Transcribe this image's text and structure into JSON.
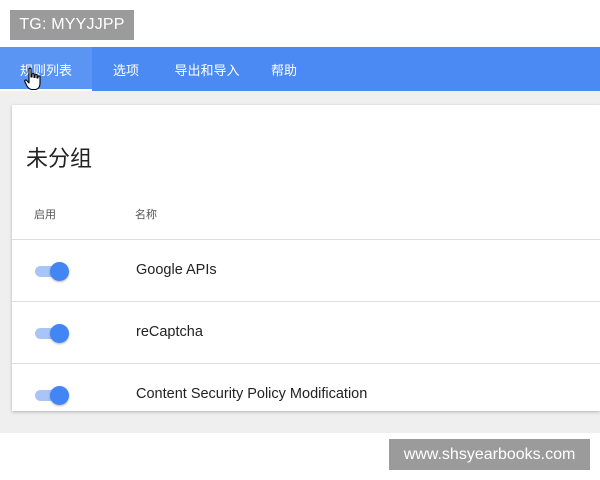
{
  "watermark_top": "TG: MYYJJPP",
  "nav": {
    "tabs": [
      {
        "label": "规则列表"
      },
      {
        "label": "选项"
      },
      {
        "label": "导出和导入"
      },
      {
        "label": "帮助"
      }
    ],
    "active_index": 0
  },
  "group": {
    "title": "未分组",
    "columns": {
      "enabled": "启用",
      "name": "名称"
    },
    "rows": [
      {
        "name": "Google APIs",
        "enabled": true
      },
      {
        "name": "reCaptcha",
        "enabled": true
      },
      {
        "name": "Content Security Policy Modification",
        "enabled": true
      }
    ]
  },
  "watermark_bottom": "www.shsyearbooks.com",
  "colors": {
    "nav_bg": "#4b8af2",
    "toggle_on": "#4285f4",
    "toggle_track": "#a9c5f7"
  }
}
